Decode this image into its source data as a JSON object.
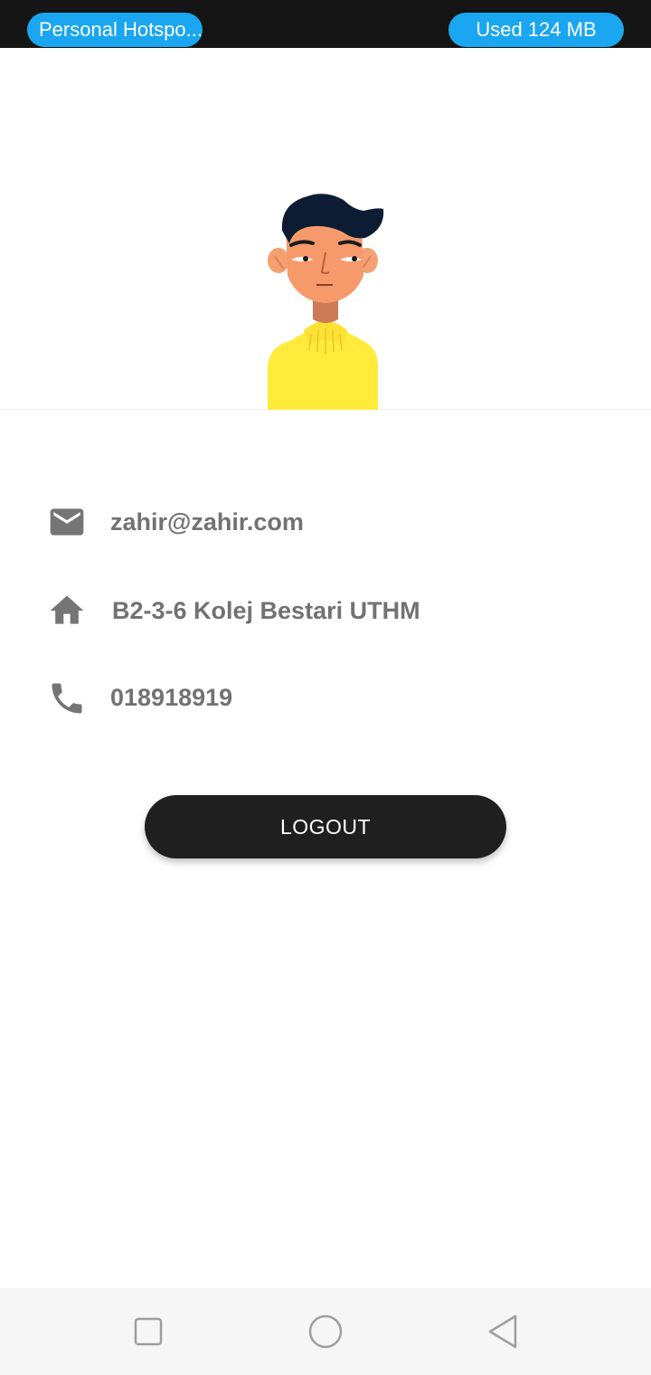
{
  "status_bar": {
    "hotspot_label": "Personal Hotspo...",
    "usage_label": "Used  124 MB"
  },
  "profile": {
    "email": "zahir@zahir.com",
    "address": "B2-3-6 Kolej Bestari UTHM",
    "phone": "018918919"
  },
  "actions": {
    "logout_label": "LOGOUT"
  },
  "icons": {
    "email": "email-icon",
    "address": "home-icon",
    "phone": "phone-icon",
    "nav_recents": "square-icon",
    "nav_home": "circle-icon",
    "nav_back": "triangle-back-icon"
  },
  "colors": {
    "status_pill": "#1aa6f0",
    "button": "#1f1f1f",
    "text": "#727272",
    "sweater": "#ffeb3b"
  }
}
